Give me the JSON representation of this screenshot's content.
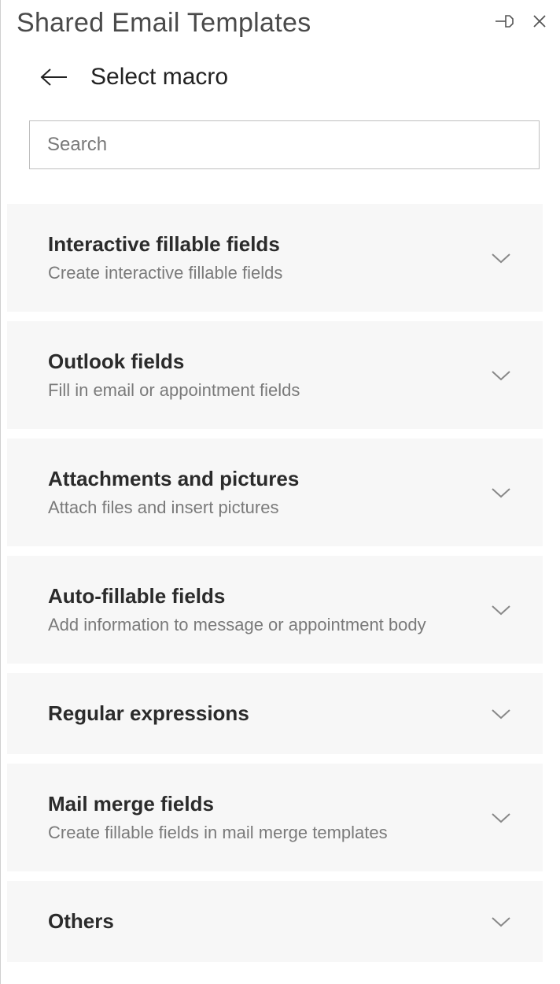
{
  "titlebar": {
    "title": "Shared Email Templates"
  },
  "page": {
    "title": "Select macro"
  },
  "search": {
    "placeholder": "Search",
    "value": ""
  },
  "categories": [
    {
      "title": "Interactive fillable fields",
      "description": "Create interactive fillable fields"
    },
    {
      "title": "Outlook fields",
      "description": "Fill in email or appointment fields"
    },
    {
      "title": "Attachments and pictures",
      "description": "Attach files and insert pictures"
    },
    {
      "title": "Auto-fillable fields",
      "description": "Add information to message or appointment body"
    },
    {
      "title": "Regular expressions",
      "description": ""
    },
    {
      "title": "Mail merge fields",
      "description": "Create fillable fields in mail merge templates"
    },
    {
      "title": "Others",
      "description": ""
    }
  ]
}
